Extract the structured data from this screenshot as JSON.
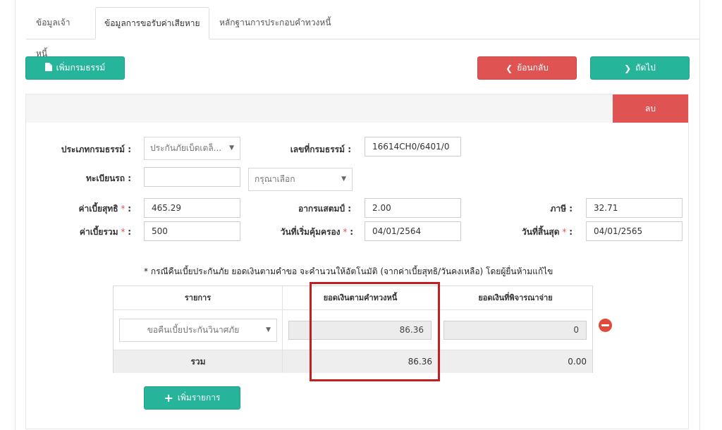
{
  "tabs": [
    {
      "label": "ข้อมูลเจ้าหนี้"
    },
    {
      "label": "ข้อมูลการขอรับค่าเสียหาย"
    },
    {
      "label": "หลักฐานการประกอบคำทวงหนี้"
    }
  ],
  "toolbar": {
    "add_policy_label": "เพิ่มกรมธรรม์",
    "back_label": "ย้อนกลับ",
    "next_label": "ถัดไป"
  },
  "panel": {
    "delete_label": "ลบ"
  },
  "form": {
    "policy_type_label": "ประเภทกรมธรรม์ :",
    "policy_type_value": "ประกันภัยเบ็ดเตล็...",
    "policy_no_label": "เลขที่กรมธรรม์ :",
    "policy_no_value": "16614CH0/6401/0",
    "registration_label": "ทะเบียนรถ :",
    "registration_value": "",
    "province_placeholder": "กรุณาเลือก",
    "net_premium_label": "ค่าเบี้ยสุทธิ",
    "net_premium_value": "465.29",
    "stamp_label": "อากรแสตมป์ :",
    "stamp_value": "2.00",
    "tax_label": "ภาษี :",
    "tax_value": "32.71",
    "total_premium_label": "ค่าเบี้ยรวม",
    "total_premium_value": "500",
    "start_date_label": "วันที่เริ่มคุ้มครอง",
    "start_date_value": "04/01/2564",
    "end_date_label": "วันที่สิ้นสุด",
    "end_date_value": "04/01/2565",
    "required_mark": "*",
    "colon": ":"
  },
  "note": "* กรณีคืนเบี้ยประกันภัย ยอดเงินตามคำขอ จะคำนวนให้อัตโนมัติ (จากค่าเบี้ยสุทธิ/วันคงเหลือ) โดยผู้ยื่นห้ามแก้ไข",
  "table": {
    "headers": [
      "รายการ",
      "ยอดเงินตามคำทวงหนี้",
      "ยอดเงินที่พิจารณาจ่าย"
    ],
    "row": {
      "item": "ขอคืนเบี้ยประกันวินาศภัย",
      "claim_amount": "86.36",
      "approved_amount": "0"
    },
    "total": {
      "label": "รวม",
      "claim_amount": "86.36",
      "approved_amount": "0.00"
    }
  },
  "add_item_label": "เพิ่มรายการ",
  "colors": {
    "green": "#26b59a",
    "red": "#df5452",
    "highlight": "#c22020"
  }
}
